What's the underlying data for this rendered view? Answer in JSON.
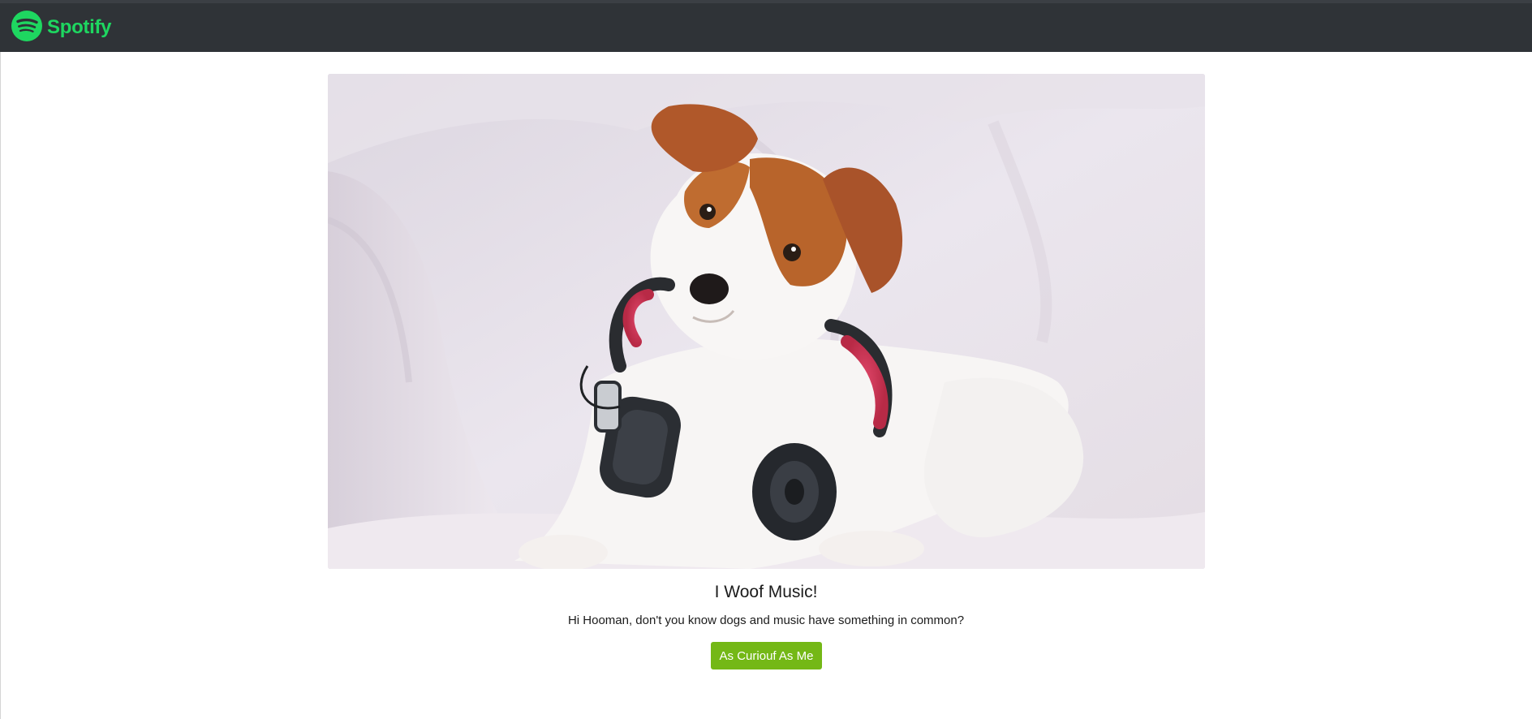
{
  "navbar": {
    "brand_name": "Spotify",
    "logo_icon": "spotify-logo-icon",
    "brand_color": "#1ed760",
    "background_color": "#2f3337"
  },
  "hero": {
    "image_description_icon": "dog-with-headphones-photo"
  },
  "content": {
    "title": "I Woof Music!",
    "subtitle": "Hi Hooman, don't you know dogs and music have something in common?",
    "cta_label": "As Curiouf As Me",
    "cta_color": "#74b816"
  }
}
